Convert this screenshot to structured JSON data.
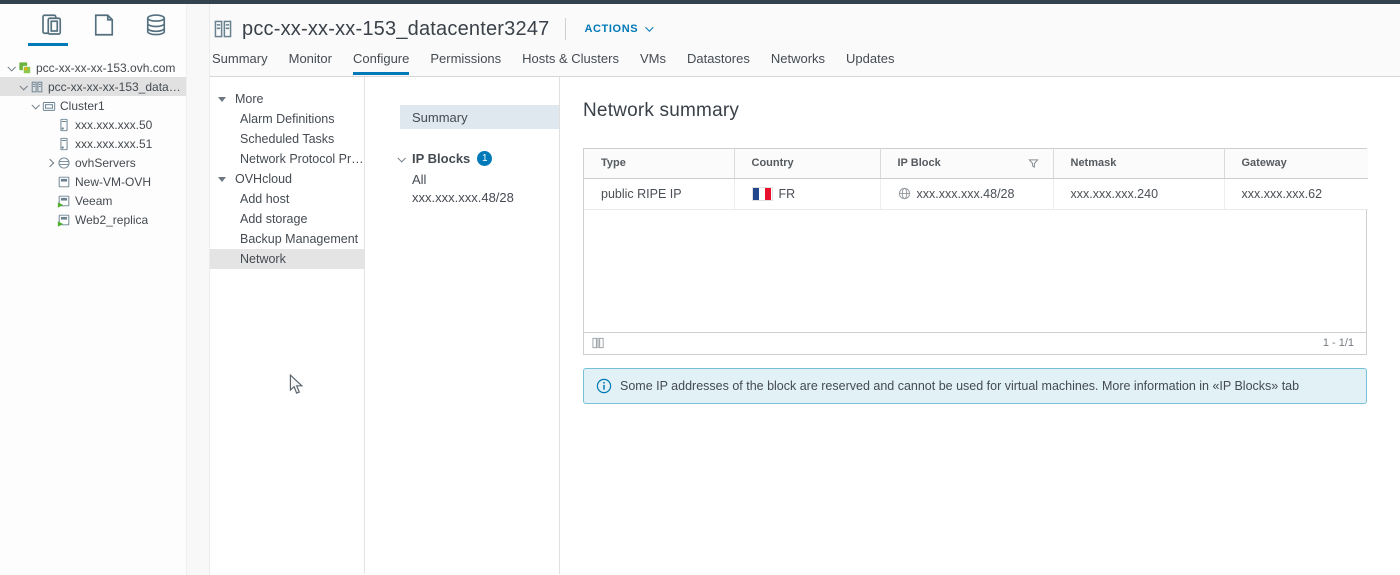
{
  "header": {
    "title": "pcc-xx-xx-xx-153_datacenter3247",
    "actions_label": "ACTIONS",
    "tabs": [
      "Summary",
      "Monitor",
      "Configure",
      "Permissions",
      "Hosts & Clusters",
      "VMs",
      "Datastores",
      "Networks",
      "Updates"
    ],
    "active_tab": "Configure"
  },
  "sidebar": {
    "nav_icons": [
      "hosts-and-clusters",
      "vms-and-templates",
      "storage",
      "networking"
    ],
    "active_nav_icon": "hosts-and-clusters",
    "tree": [
      {
        "label": "pcc-xx-xx-xx-153.ovh.com",
        "icon": "vcenter",
        "expanded": true
      },
      {
        "label": "pcc-xx-xx-xx-153_datac…",
        "icon": "datacenter",
        "expanded": true,
        "selected": true
      },
      {
        "label": "Cluster1",
        "icon": "cluster",
        "expanded": true
      },
      {
        "label": "xxx.xxx.xxx.50",
        "icon": "host"
      },
      {
        "label": "xxx.xxx.xxx.51",
        "icon": "host"
      },
      {
        "label": "ovhServers",
        "icon": "resource-pool",
        "collapsed": true
      },
      {
        "label": "New-VM-OVH",
        "icon": "vm"
      },
      {
        "label": "Veeam",
        "icon": "vm-running"
      },
      {
        "label": "Web2_replica",
        "icon": "vm-running"
      }
    ]
  },
  "configure_nav": {
    "groups": [
      {
        "label": "More",
        "items": [
          "Alarm Definitions",
          "Scheduled Tasks",
          "Network Protocol Pr…"
        ]
      },
      {
        "label": "OVHcloud",
        "items": [
          "Add host",
          "Add storage",
          "Backup Management",
          "Network"
        ]
      }
    ],
    "selected_item": "Network"
  },
  "toc": {
    "summary_label": "Summary",
    "ip_blocks_label": "IP Blocks",
    "ip_blocks_count": "1",
    "items": [
      "All",
      "xxx.xxx.xxx.48/28"
    ]
  },
  "main": {
    "title": "Network summary",
    "table": {
      "columns": [
        "Type",
        "Country",
        "IP Block",
        "Netmask",
        "Gateway"
      ],
      "rows": [
        {
          "type": "public RIPE IP",
          "country_code": "FR",
          "ip_block": "xxx.xxx.xxx.48/28",
          "netmask": "xxx.xxx.xxx.240",
          "gateway": "xxx.xxx.xxx.62"
        }
      ],
      "pagination": "1 - 1/1"
    },
    "info_banner": "Some IP addresses of the block are reserved and cannot be used for virtual machines. More information in «IP Blocks» tab"
  },
  "colors": {
    "accent_blue": "#0079b8",
    "topbar": "#33434e",
    "banner_bg": "#e1f1f6",
    "banner_border": "#77c0d9",
    "selection_gray": "#e1e1e1",
    "toc_selection": "#dfe8ee",
    "flag_blue": "#21468b",
    "flag_white": "#ffffff",
    "flag_red": "#e8112d"
  }
}
